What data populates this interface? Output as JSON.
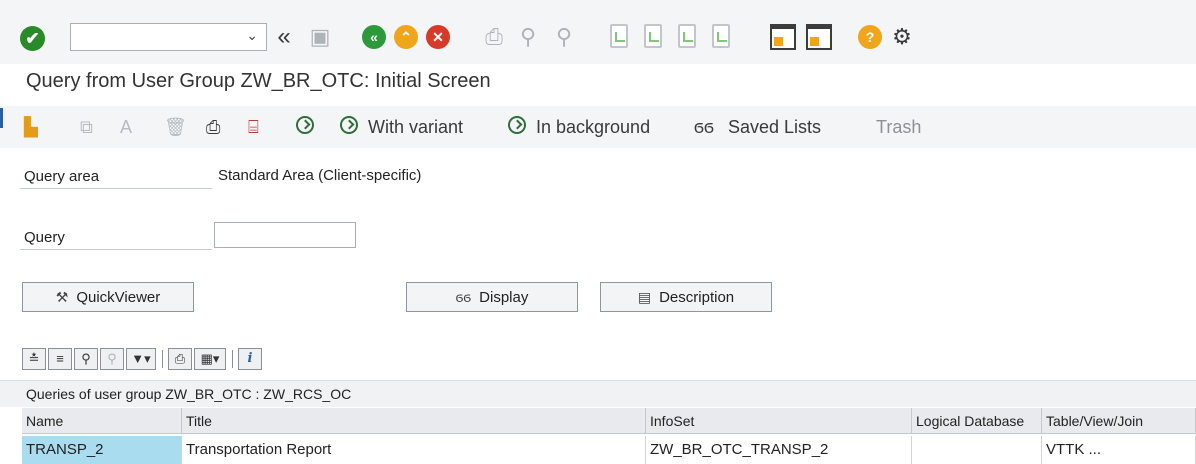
{
  "system_toolbar": {
    "command_field": {
      "value": "",
      "placeholder": ""
    },
    "icons": [
      "ok-check-icon",
      "back-double-chevron-icon",
      "save-icon",
      "back-green-icon",
      "exit-up-icon",
      "cancel-red-icon",
      "print-icon",
      "find-icon",
      "find-next-icon",
      "first-page-icon",
      "previous-page-icon",
      "next-page-icon",
      "last-page-icon",
      "new-session-icon",
      "shortcut-icon",
      "help-icon",
      "settings-icon"
    ]
  },
  "screen": {
    "title": "Query from User Group ZW_BR_OTC: Initial Screen"
  },
  "app_toolbar": {
    "with_variant": "With variant",
    "in_background": "In background",
    "saved_lists": "Saved Lists",
    "trash": "Trash"
  },
  "form": {
    "query_area_label": "Query area",
    "query_area_value": "Standard Area (Client-specific)",
    "query_label": "Query",
    "query_value": ""
  },
  "buttons": {
    "quickviewer": "QuickViewer",
    "display": "Display",
    "description": "Description"
  },
  "grid": {
    "caption": "Queries of user group ZW_BR_OTC : ZW_RCS_OC",
    "columns": [
      "Name",
      "Title",
      "InfoSet",
      "Logical Database",
      "Table/View/Join"
    ],
    "rows": [
      [
        "TRANSP_2",
        "Transportation Report",
        "ZW_BR_OTC_TRANSP_2",
        "",
        "VTTK ..."
      ]
    ]
  },
  "colors": {
    "accent_blue": "#2a5fa8",
    "selected_cell": "#a9dcef",
    "ok_green": "#2a8a2a"
  }
}
